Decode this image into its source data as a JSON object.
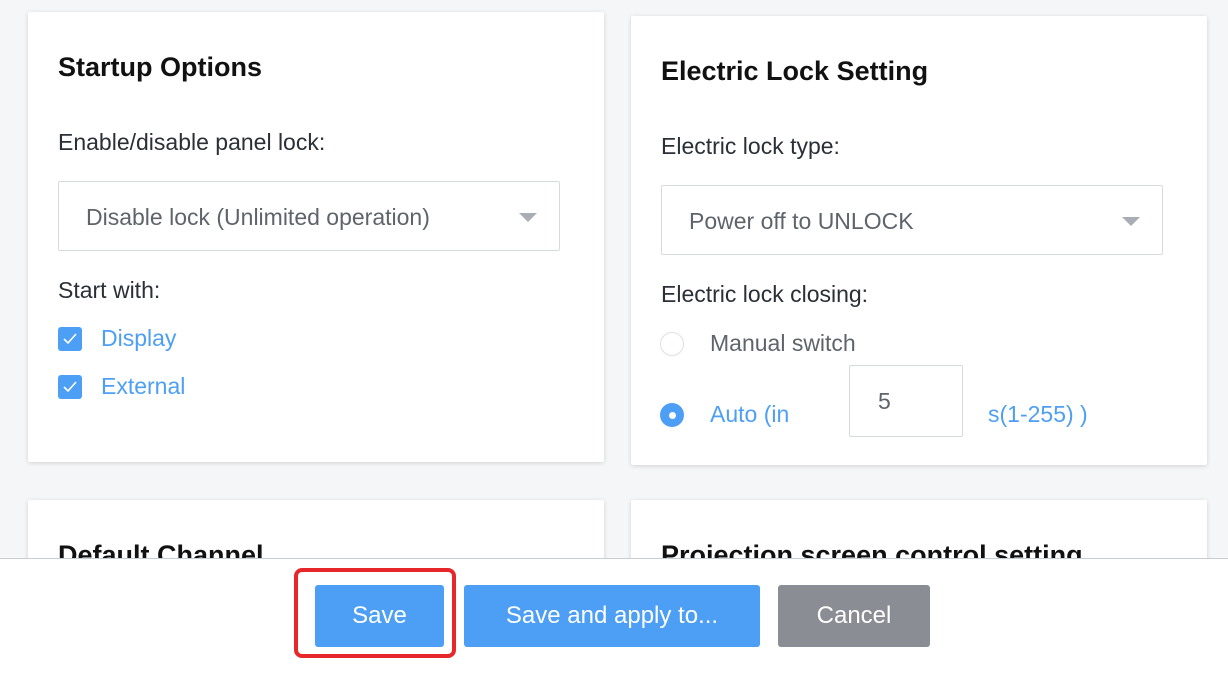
{
  "startup": {
    "title": "Startup Options",
    "panel_lock_label": "Enable/disable panel lock:",
    "panel_lock_value": "Disable lock (Unlimited operation)",
    "start_with_label": "Start with:",
    "checkboxes": [
      {
        "label": "Display",
        "checked": true
      },
      {
        "label": "External",
        "checked": true
      }
    ]
  },
  "electric_lock": {
    "title": "Electric Lock Setting",
    "type_label": "Electric lock type:",
    "type_value": "Power off to UNLOCK",
    "closing_label": "Electric lock closing:",
    "options": [
      {
        "label": "Manual switch",
        "selected": false
      },
      {
        "label": "Auto (in",
        "selected": true
      }
    ],
    "auto_seconds": "5",
    "auto_unit": "s(1-255) )"
  },
  "default_channel": {
    "title": "Default Channel"
  },
  "projection": {
    "title": "Projection screen control setting"
  },
  "footer": {
    "save_label": "Save",
    "apply_label": "Save and apply to...",
    "cancel_label": "Cancel"
  },
  "colors": {
    "accent": "#4d9ff5",
    "cancel": "#8a8d93",
    "highlight": "#e8272a"
  }
}
